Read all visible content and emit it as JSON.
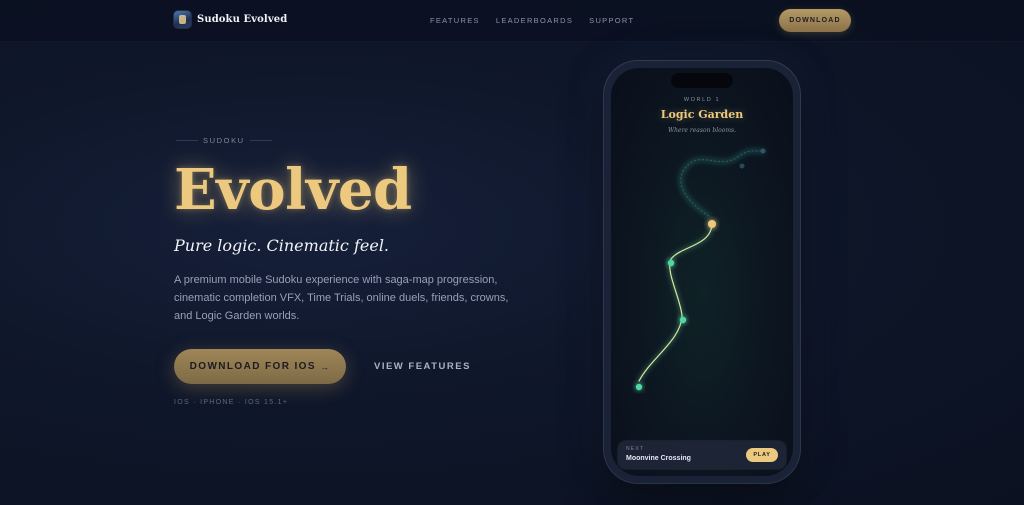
{
  "nav": {
    "brand_name": "Sudoku Evolved",
    "brand_icon": "app-logo-icon",
    "links": [
      "FEATURES",
      "LEADERBOARDS",
      "SUPPORT"
    ],
    "download_label": "DOWNLOAD"
  },
  "hero": {
    "eyebrow": "SUDOKU",
    "title": "Evolved",
    "tagline": "Pure logic. Cinematic feel.",
    "description": "A premium mobile Sudoku experience with saga-map progression, cinematic completion VFX, Time Trials, online duels, friends, crowns, and Logic Garden worlds.",
    "cta_label": "DOWNLOAD FOR IOS",
    "cta_arrow": "→",
    "secondary_label": "VIEW FEATURES",
    "platforms": "IOS · IPHONE · IOS 15.1+"
  },
  "phone": {
    "world_label": "WORLD 1",
    "world_title": "Logic Garden",
    "world_subtitle": "Where reason blooms.",
    "next_label": "NEXT",
    "next_name": "Moonvine Crossing",
    "play_label": "PLAY"
  },
  "colors": {
    "accent_gold": "#ecc97e",
    "path_teal": "#4fd7a6",
    "background": "#0f172b"
  }
}
